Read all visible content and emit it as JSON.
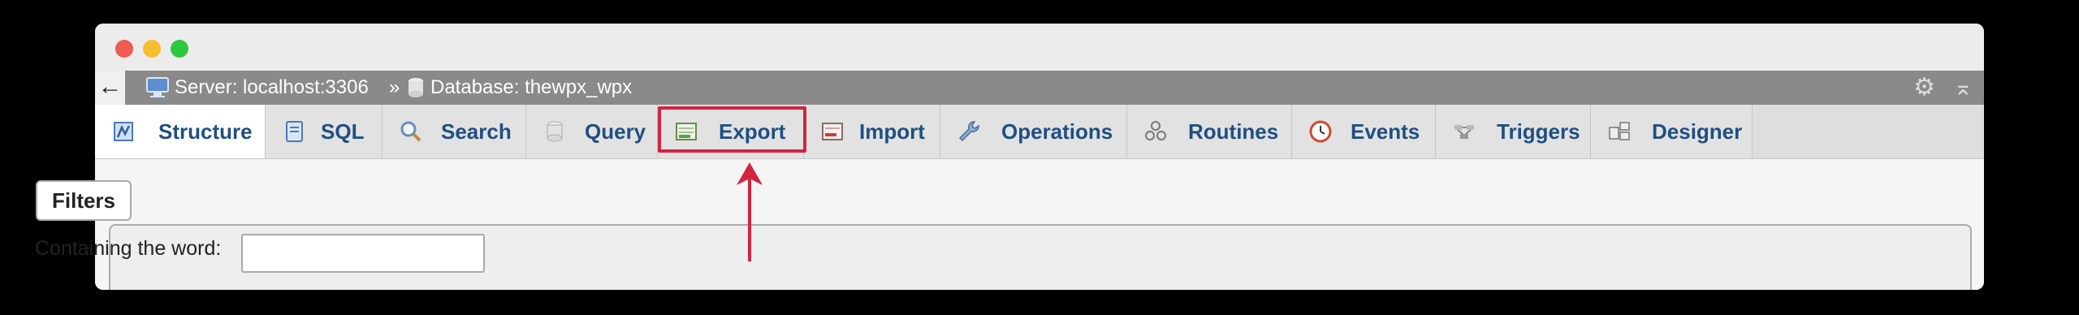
{
  "window": {
    "controls": [
      "close",
      "minimize",
      "zoom"
    ]
  },
  "breadcrumb": {
    "back_symbol": "←",
    "server_label": "Server: localhost:3306",
    "separator": "»",
    "database_label": "Database: thewpx_wpx",
    "icons": {
      "server": "server-icon",
      "database": "database-icon",
      "settings": "gear-icon",
      "collapse": "collapse-top-icon"
    }
  },
  "tabs": [
    {
      "label": "Structure",
      "icon": "structure-icon",
      "active": true
    },
    {
      "label": "SQL",
      "icon": "sql-icon",
      "active": false
    },
    {
      "label": "Search",
      "icon": "search-icon",
      "active": false
    },
    {
      "label": "Query",
      "icon": "query-icon",
      "active": false
    },
    {
      "label": "Export",
      "icon": "export-icon",
      "active": false,
      "highlighted": true
    },
    {
      "label": "Import",
      "icon": "import-icon",
      "active": false
    },
    {
      "label": "Operations",
      "icon": "wrench-icon",
      "active": false
    },
    {
      "label": "Routines",
      "icon": "routines-icon",
      "active": false
    },
    {
      "label": "Events",
      "icon": "clock-icon",
      "active": false
    },
    {
      "label": "Triggers",
      "icon": "triggers-icon",
      "active": false
    },
    {
      "label": "Designer",
      "icon": "designer-icon",
      "active": false
    }
  ],
  "filters": {
    "legend": "Filters",
    "containing_label": "Containing the word:",
    "input_value": ""
  },
  "colors": {
    "accent_tab_text": "#1f4f82",
    "highlight": "#d4233f",
    "breadcrumb_bg": "#8a8a8a"
  }
}
